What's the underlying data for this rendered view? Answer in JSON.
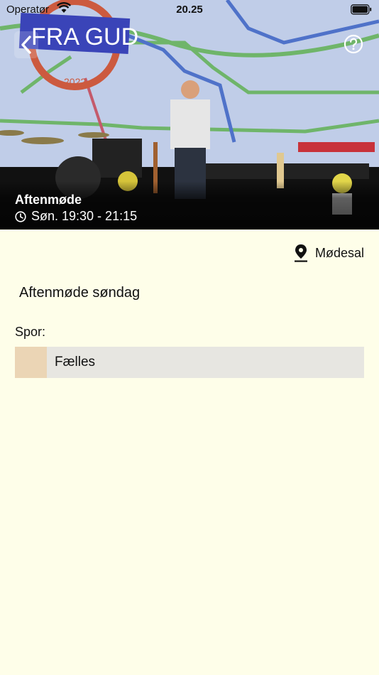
{
  "status_bar": {
    "carrier": "Operatør",
    "time": "20.25"
  },
  "hero": {
    "banner_text": "FRA GUD",
    "banner_year": "2022",
    "event_title": "Aftenmøde",
    "event_time": "Søn. 19:30 - 21:15"
  },
  "icons": {
    "back": "chevron-left-icon",
    "help": "question-circle-icon",
    "clock": "clock-icon",
    "location": "map-pin-icon"
  },
  "location": {
    "label": "Mødesal"
  },
  "description": "Aftenmøde søndag",
  "tracks": {
    "label": "Spor:",
    "items": [
      {
        "name": "Fælles",
        "color": "#ebd5b5"
      }
    ]
  },
  "colors": {
    "background": "#fefee9",
    "track_row": "#e7e6e1"
  }
}
